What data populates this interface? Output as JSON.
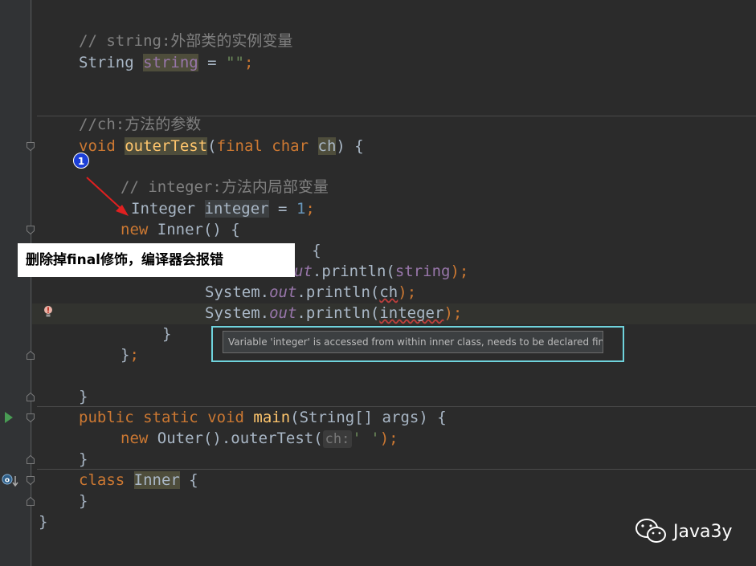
{
  "code": {
    "l1_comment": "// string:外部类的实例变量",
    "l2_type": "String",
    "l2_field": "string",
    "l2_assign": " = ",
    "l2_value": "\"\"",
    "l2_semi": ";",
    "l3_comment": "//ch:方法的参数",
    "l4_kw": "void",
    "l4_method": "outerTest",
    "l4_open": "(",
    "l4_final": "final",
    "l4_char": "char",
    "l4_param": "ch",
    "l4_close": ") {",
    "l5_comment": "// integer:方法内局部变量",
    "l6_type": "Integer",
    "l6_var": "integer",
    "l6_assign": " = ",
    "l6_value": "1",
    "l6_semi": ";",
    "l7_new": "new",
    "l7_rest": " Inner() {",
    "l8_tail": "t()  {",
    "l9_out": "ut",
    "l9_call": ".println(",
    "l9_arg": "string",
    "l9_end": ");",
    "l10_sys": "System.",
    "l10_out": "out",
    "l10_call": ".println(",
    "l10_arg": "ch",
    "l10_end": ");",
    "l11_sys": "System.",
    "l11_out": "out",
    "l11_call": ".println(",
    "l11_arg": "integer",
    "l11_end": ");",
    "l12": "}",
    "l13_brace": "}",
    "l13_semi": ";",
    "l14": "}",
    "l15_public": "public",
    "l15_static": "static",
    "l15_void": "void",
    "l15_main": "main",
    "l15_rest": "(String[] args) {",
    "l16_new": "new",
    "l16_call": " Outer().outerTest(",
    "l16_hint": "ch:",
    "l16_char": "' '",
    "l16_end": ");",
    "l17": "}",
    "l18_class": "class",
    "l18_name": "Inner",
    "l18_brace": " {",
    "l19": "}",
    "l20": "}"
  },
  "annotation": {
    "callout_text": "删除掉final修饰，编译器会报错",
    "marker_number": "1",
    "arrow_color": "#e02020"
  },
  "tooltip": {
    "text": "Variable 'integer' is accessed from within inner class, needs to be declared final"
  },
  "watermark": {
    "text": "Java3y",
    "icon": "wechat-icon"
  },
  "icons": {
    "run": "run-gutter-icon",
    "bulb": "error-lightbulb-icon",
    "implement": "implemented-marker-icon"
  }
}
